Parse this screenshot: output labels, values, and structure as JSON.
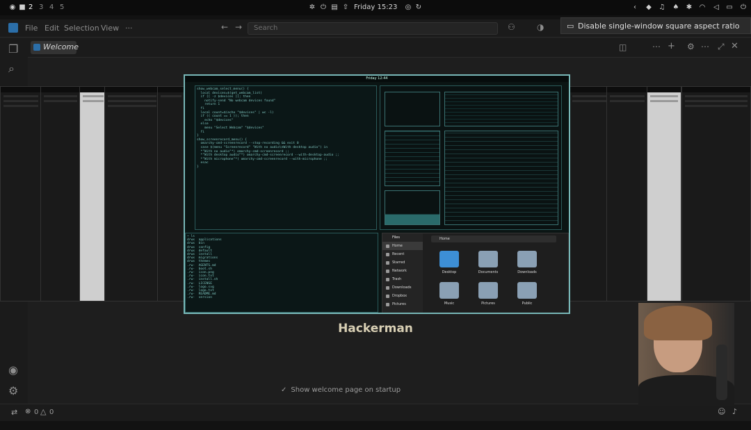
{
  "topbar": {
    "workspaces": [
      "2",
      "3",
      "4",
      "5"
    ],
    "clock": "Friday 15:23"
  },
  "editor": {
    "menu": [
      "File",
      "Edit",
      "Selection",
      "View",
      "···"
    ],
    "search_placeholder": "Search",
    "tab_label": "Welcome",
    "heading": "Hackerman",
    "show_welcome_label": "Show welcome page on startup",
    "status": {
      "errors": "0",
      "warnings": "0"
    }
  },
  "notification": {
    "label": "Disable single-window square aspect ratio"
  },
  "preview": {
    "clock": "Friday 12:44",
    "code_lines": [
      "show_webcam_select_menu() {",
      "  local devices=$(get_webcam_list)",
      "  if [[ -z $devices ]]; then",
      "    notify-send \"No webcam devices found\"",
      "    return 1",
      "  fi",
      "  local count=$(echo \"$devices\" | wc -l)",
      "  if (( count == 1 )); then",
      "    echo \"$devices\"",
      "  else",
      "    menu \"Select Webcam\" \"$devices\"",
      "  fi",
      "}",
      "",
      "show_screenrecord_menu() {",
      "  omarchy-cmd-screenrecord --stop-recording && exit 0",
      "  case $(menu \"Screenrecord\" \"With no audio\\nWith desktop audio\") in",
      "  *\"With no audio\"*) omarchy-cmd-screenrecord ;;",
      "  *\"With desktop audio\"*) omarchy-cmd-screenrecord --with-desktop-audio ;;",
      "  *\"With microphone\"*) omarchy-cmd-screenrecord --with-microphone ;;",
      "  esac",
      "}"
    ],
    "terminal_lines": [
      "~ ls",
      "drwx  applications",
      "drwx  bin",
      "drwx  config",
      "drwx  default",
      "drwx  install",
      "drwx  migrations",
      "drwx  themes",
      ".rw-  AGENTS.md",
      ".rw-  boot.sh",
      ".rw-  icon.png",
      ".rw-  icon.txt",
      ".rw-  install.sh",
      ".rw-  LICENSE",
      ".rw-  logo.svg",
      ".rw-  logo.txt",
      ".rw-  README.md",
      ".rw-  version"
    ],
    "files_title": "Files",
    "files_path": "Home",
    "files_sidebar": [
      "Home",
      "Recent",
      "Starred",
      "Network",
      "Trash",
      "Downloads",
      "Dropbox",
      "Pictures"
    ],
    "files_folders": [
      "Desktop",
      "Documents",
      "Downloads",
      "Music",
      "Pictures",
      "Public"
    ]
  },
  "colors": {
    "accent_border": "#78b8b8",
    "folder_blue": "#3d8fd6",
    "folder_gray": "#8aa0b4"
  }
}
